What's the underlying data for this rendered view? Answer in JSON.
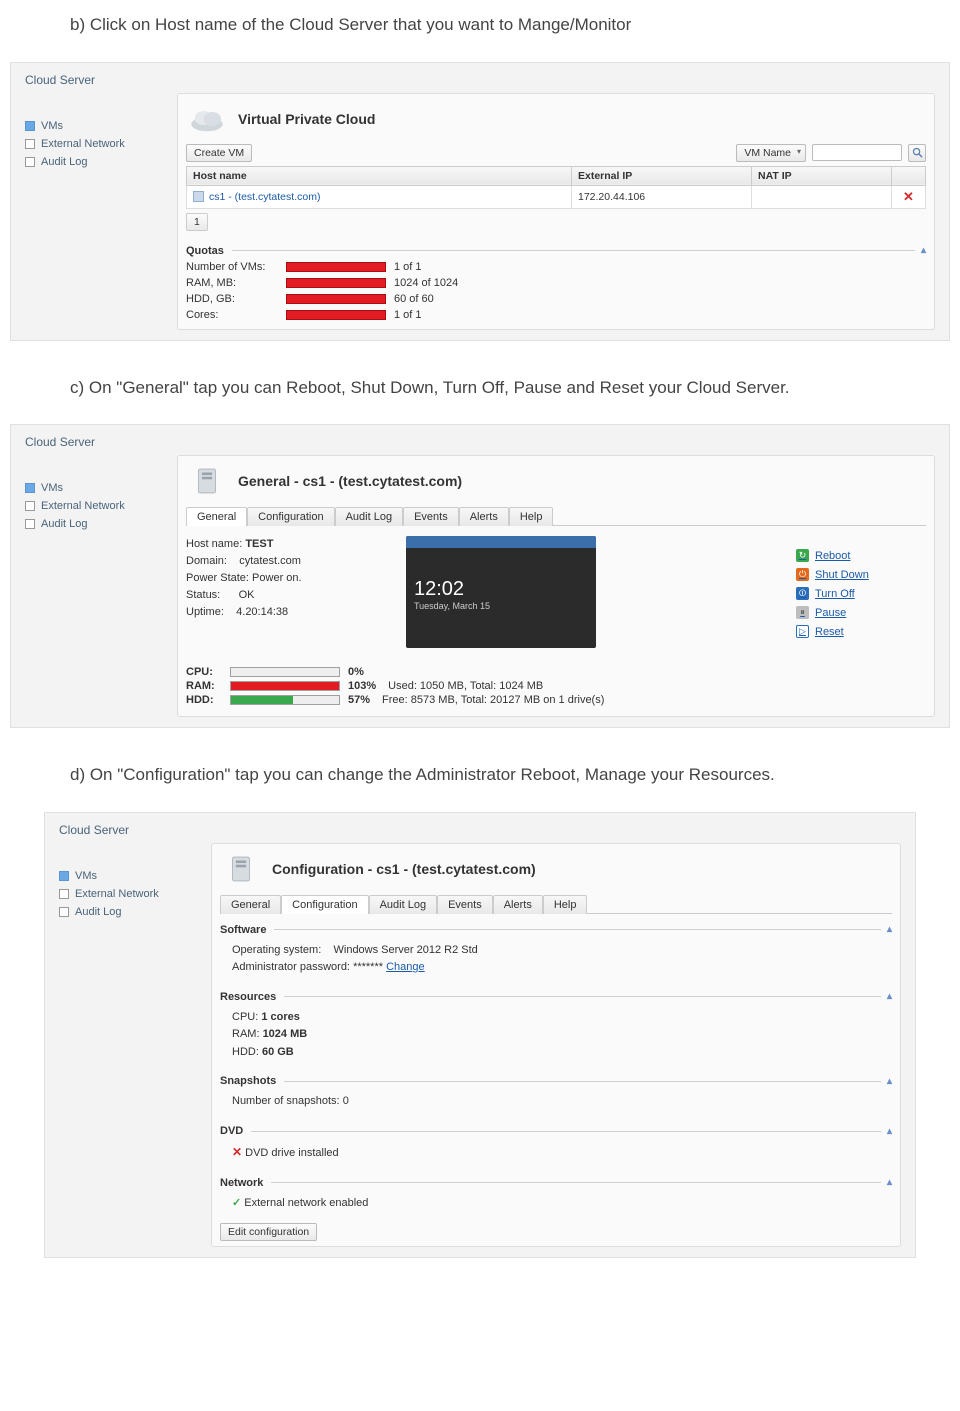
{
  "instructions": {
    "b": "b) Click on Host name of the Cloud Server that you want to Mange/Monitor",
    "c": "c) On \"General\" tap you can Reboot, Shut Down, Turn Off, Pause and Reset your Cloud Server.",
    "d": "d) On \"Configuration\" tap you can change the Administrator Reboot, Manage your Resources."
  },
  "commonSidebar": {
    "title": "Cloud Server",
    "items": [
      {
        "label": "VMs",
        "checked": true
      },
      {
        "label": "External Network",
        "checked": false
      },
      {
        "label": "Audit Log",
        "checked": false
      }
    ]
  },
  "panel1": {
    "header": "Virtual Private Cloud",
    "toolbar": {
      "createVm": "Create VM",
      "filterSel": "VM Name"
    },
    "tableHeaders": {
      "host": "Host name",
      "ext": "External IP",
      "nat": "NAT IP"
    },
    "row": {
      "host": "cs1 - (test.cytatest.com)",
      "ext": "172.20.44.106",
      "nat": ""
    },
    "pager": "1",
    "quotasTitle": "Quotas",
    "quotas": [
      {
        "label": "Number of VMs:",
        "value": "1 of 1"
      },
      {
        "label": "RAM, MB:",
        "value": "1024 of 1024"
      },
      {
        "label": "HDD, GB:",
        "value": "60 of 60"
      },
      {
        "label": "Cores:",
        "value": "1 of 1"
      }
    ]
  },
  "tabsList": [
    "General",
    "Configuration",
    "Audit Log",
    "Events",
    "Alerts",
    "Help"
  ],
  "panel2": {
    "header": "General - cs1 - (test.cytatest.com)",
    "activeTab": 0,
    "info": {
      "hostLabel": "Host name:",
      "host": "TEST",
      "domainLabel": "Domain:",
      "domain": "cytatest.com",
      "powerLabel": "Power State:",
      "power": "Power on.",
      "statusLabel": "Status:",
      "status": "OK",
      "uptimeLabel": "Uptime:",
      "uptime": "4.20:14:38"
    },
    "thumb": {
      "clock": "12:02",
      "date": "Tuesday, March 15"
    },
    "actions": [
      {
        "name": "reboot",
        "label": "Reboot",
        "cls": "reboot",
        "glyph": "↻"
      },
      {
        "name": "shutdown",
        "label": "Shut Down",
        "cls": "shut",
        "glyph": "⏻"
      },
      {
        "name": "turnoff",
        "label": "Turn Off",
        "cls": "off",
        "glyph": "⏼"
      },
      {
        "name": "pause",
        "label": "Pause",
        "cls": "pause",
        "glyph": "⏸"
      },
      {
        "name": "reset",
        "label": "Reset",
        "cls": "reset",
        "glyph": "▷"
      }
    ],
    "usage": [
      {
        "label": "CPU:",
        "pct": "0%",
        "w": 0,
        "color": "#d6d6d6",
        "note": ""
      },
      {
        "label": "RAM:",
        "pct": "103%",
        "w": 100,
        "color": "#e31b23",
        "note": "Used: 1050 MB, Total: 1024 MB"
      },
      {
        "label": "HDD:",
        "pct": "57%",
        "w": 57,
        "color": "#3aa84c",
        "note": "Free: 8573 MB, Total: 20127 MB on 1 drive(s)"
      }
    ]
  },
  "panel3": {
    "header": "Configuration - cs1 - (test.cytatest.com)",
    "activeTab": 1,
    "software": {
      "title": "Software",
      "osLabel": "Operating system:",
      "os": "Windows Server 2012 R2 Std",
      "pwLabel": "Administrator password:",
      "pwMask": "*******",
      "change": "Change"
    },
    "resources": {
      "title": "Resources",
      "cpuLabel": "CPU:",
      "cpu": "1 cores",
      "ramLabel": "RAM:",
      "ram": "1024 MB",
      "hddLabel": "HDD:",
      "hdd": "60 GB"
    },
    "snapshots": {
      "title": "Snapshots",
      "countLabel": "Number of snapshots:",
      "count": "0"
    },
    "dvd": {
      "title": "DVD",
      "statusGlyph": "✕",
      "status": "DVD drive installed"
    },
    "network": {
      "title": "Network",
      "statusGlyph": "✓",
      "status": "External network enabled"
    },
    "editBtn": "Edit configuration"
  }
}
